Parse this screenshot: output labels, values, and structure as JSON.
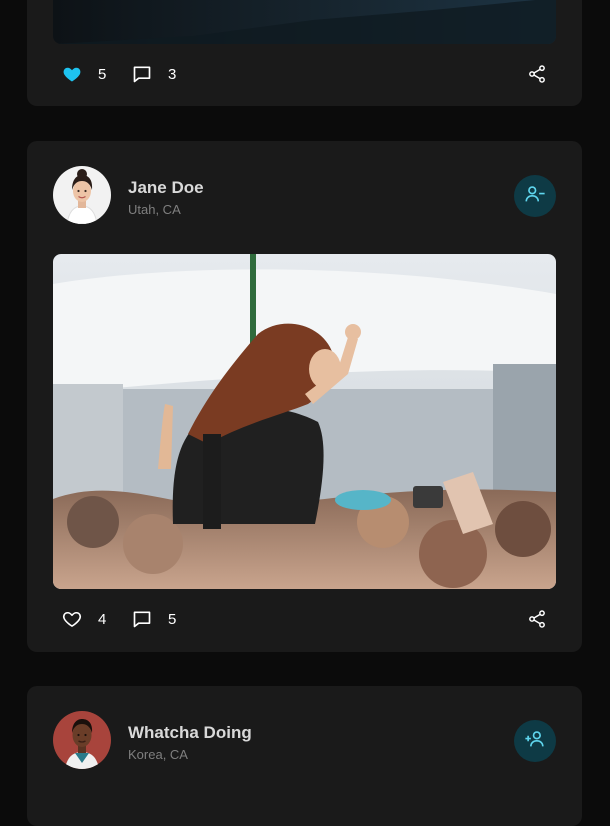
{
  "colors": {
    "background": "#0b0b0b",
    "card": "#1a1a1a",
    "accent": "#1ec3f0",
    "follow_button_bg": "#0e3a45",
    "follow_icon": "#5fd6ee"
  },
  "posts": [
    {
      "likes": "5",
      "liked": true,
      "comments": "3",
      "icons": {
        "like": "heart-filled-icon",
        "comment": "comment-icon",
        "share": "share-icon"
      }
    },
    {
      "author": "Jane Doe",
      "location": "Utah, CA",
      "follow_icon": "unfollow-user-icon",
      "likes": "4",
      "liked": false,
      "comments": "5",
      "icons": {
        "like": "heart-outline-icon",
        "comment": "comment-icon",
        "share": "share-icon"
      }
    },
    {
      "author": "Whatcha Doing",
      "location": "Korea, CA",
      "follow_icon": "add-user-icon"
    }
  ]
}
